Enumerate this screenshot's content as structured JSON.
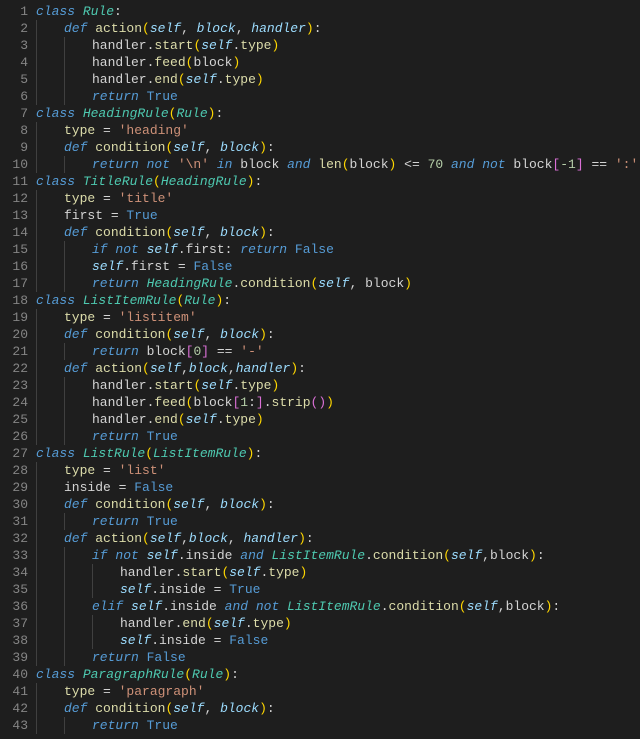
{
  "lines": [
    {
      "n": 1,
      "indent": 0,
      "tokens": [
        [
          "kw",
          "class "
        ],
        [
          "cls",
          "Rule"
        ],
        [
          "punct",
          ":"
        ]
      ]
    },
    {
      "n": 2,
      "indent": 1,
      "tokens": [
        [
          "kw",
          "def "
        ],
        [
          "fn",
          "action"
        ],
        [
          "paren",
          "("
        ],
        [
          "self",
          "self"
        ],
        [
          "punct",
          ", "
        ],
        [
          "self",
          "block"
        ],
        [
          "punct",
          ", "
        ],
        [
          "self",
          "handler"
        ],
        [
          "paren",
          ")"
        ],
        [
          "punct",
          ":"
        ]
      ]
    },
    {
      "n": 3,
      "indent": 2,
      "tokens": [
        [
          "attr",
          "handler"
        ],
        [
          "punct",
          "."
        ],
        [
          "fn",
          "start"
        ],
        [
          "paren",
          "("
        ],
        [
          "self",
          "self"
        ],
        [
          "punct",
          "."
        ],
        [
          "fn",
          "type"
        ],
        [
          "paren",
          ")"
        ]
      ]
    },
    {
      "n": 4,
      "indent": 2,
      "tokens": [
        [
          "attr",
          "handler"
        ],
        [
          "punct",
          "."
        ],
        [
          "fn",
          "feed"
        ],
        [
          "paren",
          "("
        ],
        [
          "attr",
          "block"
        ],
        [
          "paren",
          ")"
        ]
      ]
    },
    {
      "n": 5,
      "indent": 2,
      "tokens": [
        [
          "attr",
          "handler"
        ],
        [
          "punct",
          "."
        ],
        [
          "fn",
          "end"
        ],
        [
          "paren",
          "("
        ],
        [
          "self",
          "self"
        ],
        [
          "punct",
          "."
        ],
        [
          "fn",
          "type"
        ],
        [
          "paren",
          ")"
        ]
      ]
    },
    {
      "n": 6,
      "indent": 2,
      "tokens": [
        [
          "kw",
          "return "
        ],
        [
          "const",
          "True"
        ]
      ]
    },
    {
      "n": 7,
      "indent": 0,
      "tokens": [
        [
          "kw",
          "class "
        ],
        [
          "cls",
          "HeadingRule"
        ],
        [
          "paren",
          "("
        ],
        [
          "cls",
          "Rule"
        ],
        [
          "paren",
          ")"
        ],
        [
          "punct",
          ":"
        ]
      ]
    },
    {
      "n": 8,
      "indent": 1,
      "tokens": [
        [
          "fn",
          "type"
        ],
        [
          "op",
          " = "
        ],
        [
          "str",
          "'heading'"
        ]
      ]
    },
    {
      "n": 9,
      "indent": 1,
      "tokens": [
        [
          "kw",
          "def "
        ],
        [
          "fn",
          "condition"
        ],
        [
          "paren",
          "("
        ],
        [
          "self",
          "self"
        ],
        [
          "punct",
          ", "
        ],
        [
          "self",
          "block"
        ],
        [
          "paren",
          ")"
        ],
        [
          "punct",
          ":"
        ]
      ]
    },
    {
      "n": 10,
      "indent": 2,
      "tokens": [
        [
          "kw",
          "return "
        ],
        [
          "kw",
          "not "
        ],
        [
          "str",
          "'\\n'"
        ],
        [
          "kw",
          " in "
        ],
        [
          "attr",
          "block"
        ],
        [
          "kw",
          " and "
        ],
        [
          "fn",
          "len"
        ],
        [
          "paren",
          "("
        ],
        [
          "attr",
          "block"
        ],
        [
          "paren",
          ")"
        ],
        [
          "op",
          " <= "
        ],
        [
          "num",
          "70"
        ],
        [
          "kw",
          " and "
        ],
        [
          "kw",
          "not "
        ],
        [
          "attr",
          "block"
        ],
        [
          "brk",
          "["
        ],
        [
          "num",
          "-1"
        ],
        [
          "brk",
          "]"
        ],
        [
          "op",
          " == "
        ],
        [
          "str",
          "':'"
        ]
      ]
    },
    {
      "n": 11,
      "indent": 0,
      "tokens": [
        [
          "kw",
          "class "
        ],
        [
          "cls",
          "TitleRule"
        ],
        [
          "paren",
          "("
        ],
        [
          "cls",
          "HeadingRule"
        ],
        [
          "paren",
          ")"
        ],
        [
          "punct",
          ":"
        ]
      ]
    },
    {
      "n": 12,
      "indent": 1,
      "tokens": [
        [
          "fn",
          "type"
        ],
        [
          "op",
          " = "
        ],
        [
          "str",
          "'title'"
        ]
      ]
    },
    {
      "n": 13,
      "indent": 1,
      "tokens": [
        [
          "attr",
          "first"
        ],
        [
          "op",
          " = "
        ],
        [
          "const",
          "True"
        ]
      ]
    },
    {
      "n": 14,
      "indent": 1,
      "tokens": [
        [
          "kw",
          "def "
        ],
        [
          "fn",
          "condition"
        ],
        [
          "paren",
          "("
        ],
        [
          "self",
          "self"
        ],
        [
          "punct",
          ", "
        ],
        [
          "self",
          "block"
        ],
        [
          "paren",
          ")"
        ],
        [
          "punct",
          ":"
        ]
      ]
    },
    {
      "n": 15,
      "indent": 2,
      "tokens": [
        [
          "kw",
          "if "
        ],
        [
          "kw",
          "not "
        ],
        [
          "self",
          "self"
        ],
        [
          "punct",
          "."
        ],
        [
          "attr",
          "first"
        ],
        [
          "punct",
          ": "
        ],
        [
          "kw",
          "return "
        ],
        [
          "const",
          "False"
        ]
      ]
    },
    {
      "n": 16,
      "indent": 2,
      "tokens": [
        [
          "self",
          "self"
        ],
        [
          "punct",
          "."
        ],
        [
          "attr",
          "first"
        ],
        [
          "op",
          " = "
        ],
        [
          "const",
          "False"
        ]
      ]
    },
    {
      "n": 17,
      "indent": 2,
      "tokens": [
        [
          "kw",
          "return "
        ],
        [
          "cls",
          "HeadingRule"
        ],
        [
          "punct",
          "."
        ],
        [
          "fn",
          "condition"
        ],
        [
          "paren",
          "("
        ],
        [
          "self",
          "self"
        ],
        [
          "punct",
          ", "
        ],
        [
          "attr",
          "block"
        ],
        [
          "paren",
          ")"
        ]
      ]
    },
    {
      "n": 18,
      "indent": 0,
      "tokens": [
        [
          "kw",
          "class "
        ],
        [
          "cls",
          "ListItemRule"
        ],
        [
          "paren",
          "("
        ],
        [
          "cls",
          "Rule"
        ],
        [
          "paren",
          ")"
        ],
        [
          "punct",
          ":"
        ]
      ]
    },
    {
      "n": 19,
      "indent": 1,
      "tokens": [
        [
          "fn",
          "type"
        ],
        [
          "op",
          " = "
        ],
        [
          "str",
          "'listitem'"
        ]
      ]
    },
    {
      "n": 20,
      "indent": 1,
      "tokens": [
        [
          "kw",
          "def "
        ],
        [
          "fn",
          "condition"
        ],
        [
          "paren",
          "("
        ],
        [
          "self",
          "self"
        ],
        [
          "punct",
          ", "
        ],
        [
          "self",
          "block"
        ],
        [
          "paren",
          ")"
        ],
        [
          "punct",
          ":"
        ]
      ]
    },
    {
      "n": 21,
      "indent": 2,
      "tokens": [
        [
          "kw",
          "return "
        ],
        [
          "attr",
          "block"
        ],
        [
          "brk",
          "["
        ],
        [
          "num",
          "0"
        ],
        [
          "brk",
          "]"
        ],
        [
          "op",
          " == "
        ],
        [
          "str",
          "'-'"
        ]
      ]
    },
    {
      "n": 22,
      "indent": 1,
      "tokens": [
        [
          "kw",
          "def "
        ],
        [
          "fn",
          "action"
        ],
        [
          "paren",
          "("
        ],
        [
          "self",
          "self"
        ],
        [
          "punct",
          ","
        ],
        [
          "self",
          "block"
        ],
        [
          "punct",
          ","
        ],
        [
          "self",
          "handler"
        ],
        [
          "paren",
          ")"
        ],
        [
          "punct",
          ":"
        ]
      ]
    },
    {
      "n": 23,
      "indent": 2,
      "tokens": [
        [
          "attr",
          "handler"
        ],
        [
          "punct",
          "."
        ],
        [
          "fn",
          "start"
        ],
        [
          "paren",
          "("
        ],
        [
          "self",
          "self"
        ],
        [
          "punct",
          "."
        ],
        [
          "fn",
          "type"
        ],
        [
          "paren",
          ")"
        ]
      ]
    },
    {
      "n": 24,
      "indent": 2,
      "tokens": [
        [
          "attr",
          "handler"
        ],
        [
          "punct",
          "."
        ],
        [
          "fn",
          "feed"
        ],
        [
          "paren",
          "("
        ],
        [
          "attr",
          "block"
        ],
        [
          "brk",
          "["
        ],
        [
          "num",
          "1"
        ],
        [
          "punct",
          ":"
        ],
        [
          "brk",
          "]"
        ],
        [
          "punct",
          "."
        ],
        [
          "fn",
          "strip"
        ],
        [
          "brk",
          "("
        ],
        [
          "brk",
          ")"
        ],
        [
          "paren",
          ")"
        ]
      ]
    },
    {
      "n": 25,
      "indent": 2,
      "tokens": [
        [
          "attr",
          "handler"
        ],
        [
          "punct",
          "."
        ],
        [
          "fn",
          "end"
        ],
        [
          "paren",
          "("
        ],
        [
          "self",
          "self"
        ],
        [
          "punct",
          "."
        ],
        [
          "fn",
          "type"
        ],
        [
          "paren",
          ")"
        ]
      ]
    },
    {
      "n": 26,
      "indent": 2,
      "tokens": [
        [
          "kw",
          "return "
        ],
        [
          "const",
          "True"
        ]
      ]
    },
    {
      "n": 27,
      "indent": 0,
      "tokens": [
        [
          "kw",
          "class "
        ],
        [
          "cls",
          "ListRule"
        ],
        [
          "paren",
          "("
        ],
        [
          "cls",
          "ListItemRule"
        ],
        [
          "paren",
          ")"
        ],
        [
          "punct",
          ":"
        ]
      ]
    },
    {
      "n": 28,
      "indent": 1,
      "tokens": [
        [
          "fn",
          "type"
        ],
        [
          "op",
          " = "
        ],
        [
          "str",
          "'list'"
        ]
      ]
    },
    {
      "n": 29,
      "indent": 1,
      "tokens": [
        [
          "attr",
          "inside"
        ],
        [
          "op",
          " = "
        ],
        [
          "const",
          "False"
        ]
      ]
    },
    {
      "n": 30,
      "indent": 1,
      "tokens": [
        [
          "kw",
          "def "
        ],
        [
          "fn",
          "condition"
        ],
        [
          "paren",
          "("
        ],
        [
          "self",
          "self"
        ],
        [
          "punct",
          ", "
        ],
        [
          "self",
          "block"
        ],
        [
          "paren",
          ")"
        ],
        [
          "punct",
          ":"
        ]
      ]
    },
    {
      "n": 31,
      "indent": 2,
      "tokens": [
        [
          "kw",
          "return "
        ],
        [
          "const",
          "True"
        ]
      ]
    },
    {
      "n": 32,
      "indent": 1,
      "tokens": [
        [
          "kw",
          "def "
        ],
        [
          "fn",
          "action"
        ],
        [
          "paren",
          "("
        ],
        [
          "self",
          "self"
        ],
        [
          "punct",
          ","
        ],
        [
          "self",
          "block"
        ],
        [
          "punct",
          ", "
        ],
        [
          "self",
          "handler"
        ],
        [
          "paren",
          ")"
        ],
        [
          "punct",
          ":"
        ]
      ]
    },
    {
      "n": 33,
      "indent": 2,
      "tokens": [
        [
          "kw",
          "if "
        ],
        [
          "kw",
          "not "
        ],
        [
          "self",
          "self"
        ],
        [
          "punct",
          "."
        ],
        [
          "attr",
          "inside"
        ],
        [
          "kw",
          " and "
        ],
        [
          "cls",
          "ListItemRule"
        ],
        [
          "punct",
          "."
        ],
        [
          "fn",
          "condition"
        ],
        [
          "paren",
          "("
        ],
        [
          "self",
          "self"
        ],
        [
          "punct",
          ","
        ],
        [
          "attr",
          "block"
        ],
        [
          "paren",
          ")"
        ],
        [
          "punct",
          ":"
        ]
      ]
    },
    {
      "n": 34,
      "indent": 3,
      "tokens": [
        [
          "attr",
          "handler"
        ],
        [
          "punct",
          "."
        ],
        [
          "fn",
          "start"
        ],
        [
          "paren",
          "("
        ],
        [
          "self",
          "self"
        ],
        [
          "punct",
          "."
        ],
        [
          "fn",
          "type"
        ],
        [
          "paren",
          ")"
        ]
      ]
    },
    {
      "n": 35,
      "indent": 3,
      "tokens": [
        [
          "self",
          "self"
        ],
        [
          "punct",
          "."
        ],
        [
          "attr",
          "inside"
        ],
        [
          "op",
          " = "
        ],
        [
          "const",
          "True"
        ]
      ]
    },
    {
      "n": 36,
      "indent": 2,
      "tokens": [
        [
          "kw",
          "elif "
        ],
        [
          "self",
          "self"
        ],
        [
          "punct",
          "."
        ],
        [
          "attr",
          "inside"
        ],
        [
          "kw",
          " and "
        ],
        [
          "kw",
          "not "
        ],
        [
          "cls",
          "ListItemRule"
        ],
        [
          "punct",
          "."
        ],
        [
          "fn",
          "condition"
        ],
        [
          "paren",
          "("
        ],
        [
          "self",
          "self"
        ],
        [
          "punct",
          ","
        ],
        [
          "attr",
          "block"
        ],
        [
          "paren",
          ")"
        ],
        [
          "punct",
          ":"
        ]
      ]
    },
    {
      "n": 37,
      "indent": 3,
      "tokens": [
        [
          "attr",
          "handler"
        ],
        [
          "punct",
          "."
        ],
        [
          "fn",
          "end"
        ],
        [
          "paren",
          "("
        ],
        [
          "self",
          "self"
        ],
        [
          "punct",
          "."
        ],
        [
          "fn",
          "type"
        ],
        [
          "paren",
          ")"
        ]
      ]
    },
    {
      "n": 38,
      "indent": 3,
      "tokens": [
        [
          "self",
          "self"
        ],
        [
          "punct",
          "."
        ],
        [
          "attr",
          "inside"
        ],
        [
          "op",
          " = "
        ],
        [
          "const",
          "False"
        ]
      ]
    },
    {
      "n": 39,
      "indent": 2,
      "tokens": [
        [
          "kw",
          "return "
        ],
        [
          "const",
          "False"
        ]
      ]
    },
    {
      "n": 40,
      "indent": 0,
      "tokens": [
        [
          "kw",
          "class "
        ],
        [
          "cls",
          "ParagraphRule"
        ],
        [
          "paren",
          "("
        ],
        [
          "cls",
          "Rule"
        ],
        [
          "paren",
          ")"
        ],
        [
          "punct",
          ":"
        ]
      ]
    },
    {
      "n": 41,
      "indent": 1,
      "tokens": [
        [
          "fn",
          "type"
        ],
        [
          "op",
          " = "
        ],
        [
          "str",
          "'paragraph'"
        ]
      ]
    },
    {
      "n": 42,
      "indent": 1,
      "tokens": [
        [
          "kw",
          "def "
        ],
        [
          "fn",
          "condition"
        ],
        [
          "paren",
          "("
        ],
        [
          "self",
          "self"
        ],
        [
          "punct",
          ", "
        ],
        [
          "self",
          "block"
        ],
        [
          "paren",
          ")"
        ],
        [
          "punct",
          ":"
        ]
      ]
    },
    {
      "n": 43,
      "indent": 2,
      "tokens": [
        [
          "kw",
          "return "
        ],
        [
          "const",
          "True"
        ]
      ]
    }
  ]
}
